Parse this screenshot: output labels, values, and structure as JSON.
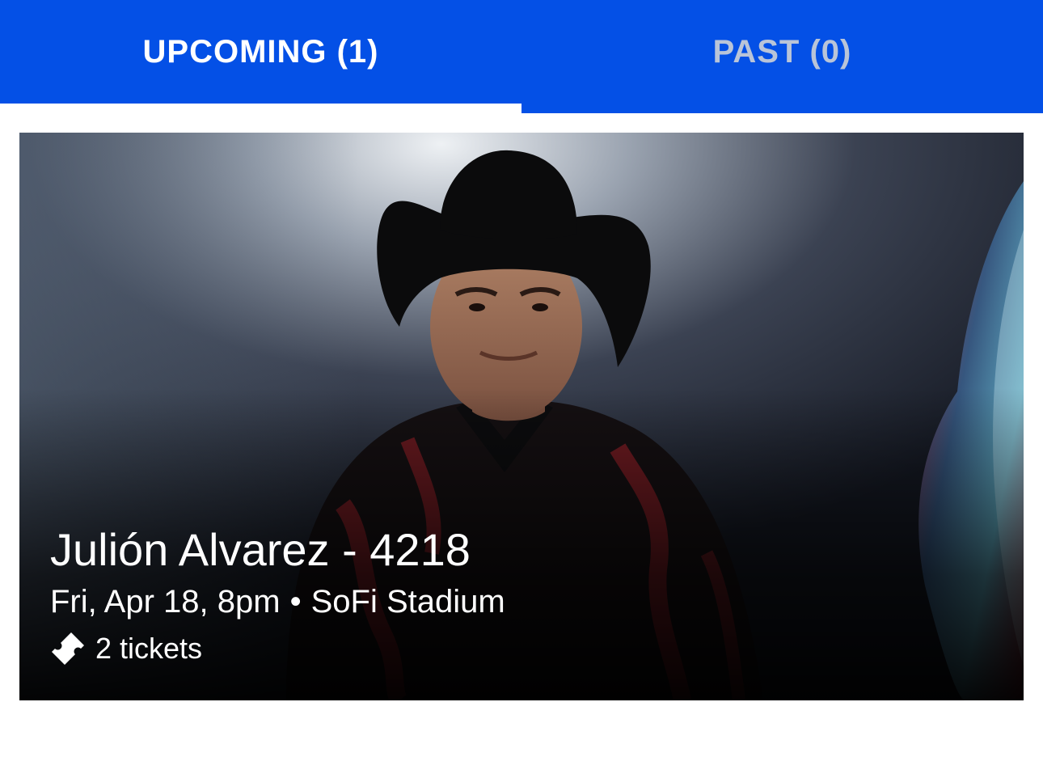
{
  "tabs": {
    "upcoming_label": "UPCOMING (1)",
    "past_label": "PAST (0)",
    "active": "upcoming"
  },
  "event": {
    "title": "Julión Alvarez - 4218",
    "date_time": "Fri, Apr 18, 8pm",
    "separator": "•",
    "venue": "SoFi Stadium",
    "tickets": "2 tickets",
    "ticket_icon": "ticket-icon"
  },
  "colors": {
    "brand_blue": "#0450e6",
    "tab_active_text": "#ffffff",
    "tab_inactive_text": "#b9c4d8"
  }
}
